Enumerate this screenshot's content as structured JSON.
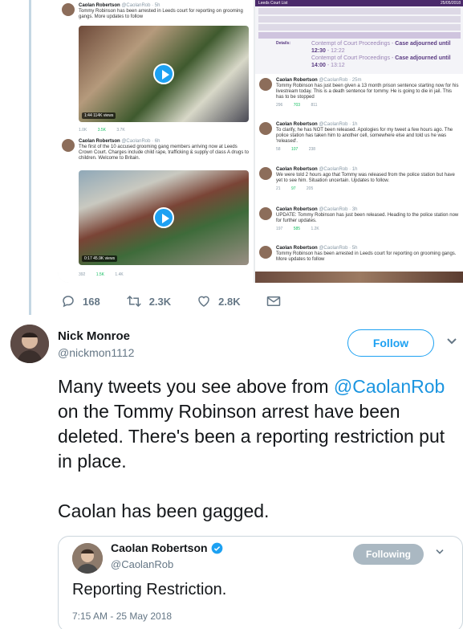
{
  "embedded_image": {
    "left_column": [
      {
        "name": "Caolan Robertson",
        "handle": "@CaolanRob · 5h",
        "text": "Tommy Robinson has been arrested in Leeds court for reporting on grooming gangs. More updates to follow",
        "video_badge": "1:44  114K views",
        "actions": [
          "1.0K",
          "3.5K",
          "3.7K"
        ]
      },
      {
        "name": "Caolan Robertson",
        "handle": "@CaolanRob · 6h",
        "text": "The first of the 10 accused grooming gang members arriving now at Leeds Crown Court. Charges include child rape, trafficking & supply of class A drugs to children. Welcome to Britain.",
        "video_badge": "0:17  45.9K views",
        "actions": [
          "392",
          "1.5K",
          "1.4K"
        ]
      }
    ],
    "court_panel": {
      "title": "Leeds Court List",
      "date": "25/05/2018",
      "details_label": "Details:",
      "line1": "Contempt of Court Proceedings - ",
      "line1_bold": "Case adjourned until 12:30",
      "line1_time": " - 12:22",
      "line2": "Contempt of Court Proceedings - ",
      "line2_bold": "Case adjourned until 14:00",
      "line2_time": " - 13:12"
    },
    "right_column": [
      {
        "name": "Caolan Robertson",
        "handle": "@CaolanRob · 25m",
        "text": "Tommy Robinson has just been given a 13 month prison sentence starting now for his livestream today. This is a death sentence for tommy. He is going to die in jail. This has to be stopped",
        "actions": [
          "296",
          "703",
          "811"
        ]
      },
      {
        "name": "Caolan Robertson",
        "handle": "@CaolanRob · 1h",
        "text": "To clarify, he has NOT been released. Apologies for my tweet a few hours ago. The police station has taken him to another cell, somewhere else and told us he was 'released'.",
        "actions": [
          "58",
          "107",
          "238"
        ]
      },
      {
        "name": "Caolan Robertson",
        "handle": "@CaolanRob · 1h",
        "text": "We were told 2 hours ago that Tommy was released from the police station but have yet to see him. Situation uncertain. Updates to follow.",
        "actions": [
          "21",
          "97",
          "205"
        ]
      },
      {
        "name": "Caolan Robertson",
        "handle": "@CaolanRob · 3h",
        "text": "UPDATE: Tommy Robinson has just been released. Heading to the police station now for further updates.",
        "actions": [
          "197",
          "585",
          "1.2K"
        ]
      },
      {
        "name": "Caolan Robertson",
        "handle": "@CaolanRob · 5h",
        "text": "Tommy Robinson has been arrested in Leeds court for reporting on grooming gangs. More updates to follow",
        "actions": []
      }
    ]
  },
  "first_tweet_actions": {
    "replies": "168",
    "retweets": "2.3K",
    "likes": "2.8K"
  },
  "tweet": {
    "name": "Nick Monroe",
    "handle": "@nickmon1112",
    "follow_label": "Follow",
    "text_prefix": "Many tweets you see above from ",
    "mention": "@CaolanRob",
    "text_suffix": " on the Tommy Robinson arrest have been deleted. There's been a reporting restriction put in place.",
    "text_second": "Caolan has been gagged."
  },
  "quoted_tweet": {
    "name": "Caolan Robertson",
    "handle": "@CaolanRob",
    "follow_label": "Following",
    "text": "Reporting Restriction.",
    "timestamp": "7:15 AM - 25 May 2018"
  },
  "colors": {
    "accent": "#1da1f2",
    "mention": "#1b95e0",
    "secondary_text": "#657786",
    "retweet": "#17bf63"
  }
}
